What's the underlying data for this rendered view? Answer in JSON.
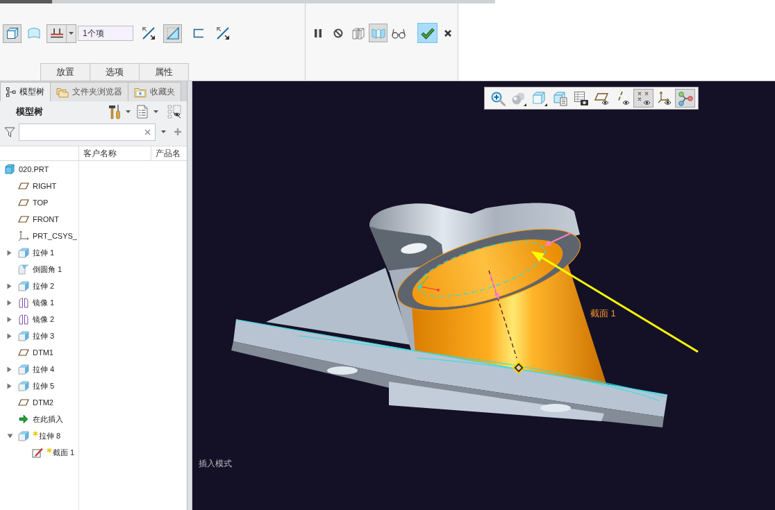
{
  "ribbon": {
    "tools_left": [
      {
        "kind": "solid",
        "on": true
      },
      {
        "kind": "surface",
        "on": false
      },
      {
        "kind": "depth",
        "on": false
      }
    ],
    "collector": {
      "value": "1个项"
    },
    "tools_right": [
      {
        "kind": "flip",
        "on": false
      },
      {
        "kind": "remove-material",
        "on": true
      },
      {
        "kind": "thicken",
        "on": false
      },
      {
        "kind": "flip",
        "on": false
      }
    ],
    "panel_tabs": [
      "放置",
      "选项",
      "属性"
    ],
    "mode_tools": [
      {
        "kind": "pause",
        "on": false
      },
      {
        "kind": "stop",
        "on": false
      },
      {
        "kind": "no-preview",
        "on": false
      },
      {
        "kind": "preview",
        "on": true
      },
      {
        "kind": "verify",
        "on": false
      }
    ],
    "actions": [
      {
        "kind": "ok"
      },
      {
        "kind": "cancel"
      }
    ]
  },
  "navigator": {
    "tabs": [
      {
        "label": "模型树",
        "kind": "tree",
        "selected": true
      },
      {
        "label": "文件夹浏览器",
        "kind": "folder",
        "selected": false
      },
      {
        "label": "收藏夹",
        "kind": "favorites",
        "selected": false
      }
    ],
    "title": "模型树",
    "columns": [
      "客户名称",
      "产品名"
    ],
    "tree": [
      {
        "label": "020.PRT",
        "kind": "part",
        "new": false,
        "children": [
          {
            "label": "RIGHT",
            "kind": "plane",
            "new": false
          },
          {
            "label": "TOP",
            "kind": "plane",
            "new": false
          },
          {
            "label": "FRONT",
            "kind": "plane",
            "new": false
          },
          {
            "label": "PRT_CSYS_",
            "kind": "csys",
            "new": false
          },
          {
            "label": "拉伸 1",
            "kind": "extrude",
            "new": false,
            "expanded": false
          },
          {
            "label": "倒圆角 1",
            "kind": "round",
            "new": false
          },
          {
            "label": "拉伸 2",
            "kind": "extrude",
            "new": false,
            "expanded": false
          },
          {
            "label": "镜像 1",
            "kind": "mirror",
            "new": false,
            "expanded": false
          },
          {
            "label": "镜像 2",
            "kind": "mirror",
            "new": false,
            "expanded": false
          },
          {
            "label": "拉伸 3",
            "kind": "extrude",
            "new": false,
            "expanded": false
          },
          {
            "label": "DTM1",
            "kind": "plane",
            "new": false
          },
          {
            "label": "拉伸 4",
            "kind": "extrude",
            "new": false,
            "expanded": false
          },
          {
            "label": "拉伸 5",
            "kind": "extrude",
            "new": false,
            "expanded": false
          },
          {
            "label": "DTM2",
            "kind": "plane",
            "new": false
          },
          {
            "label": "在此插入",
            "kind": "insert",
            "new": false
          },
          {
            "label": "拉伸 8",
            "kind": "extrude",
            "new": true,
            "expanded": true,
            "children": [
              {
                "label": "截面 1",
                "kind": "sketch",
                "new": true
              }
            ]
          }
        ]
      }
    ]
  },
  "viewport": {
    "toolbar": [
      {
        "kind": "zoom-in",
        "on": false
      },
      {
        "kind": "display-style",
        "on": false
      },
      {
        "kind": "saved-views",
        "on": false
      },
      {
        "kind": "view-manager",
        "on": false
      },
      {
        "kind": "appearance",
        "on": false
      },
      {
        "kind": "plane-display",
        "on": false
      },
      {
        "kind": "axis-display",
        "on": false
      },
      {
        "kind": "point-display",
        "on": true
      },
      {
        "kind": "csys-display",
        "on": false
      },
      {
        "kind": "spin-center",
        "on": true
      }
    ],
    "section_label": "截面 1",
    "status": "插入模式"
  }
}
